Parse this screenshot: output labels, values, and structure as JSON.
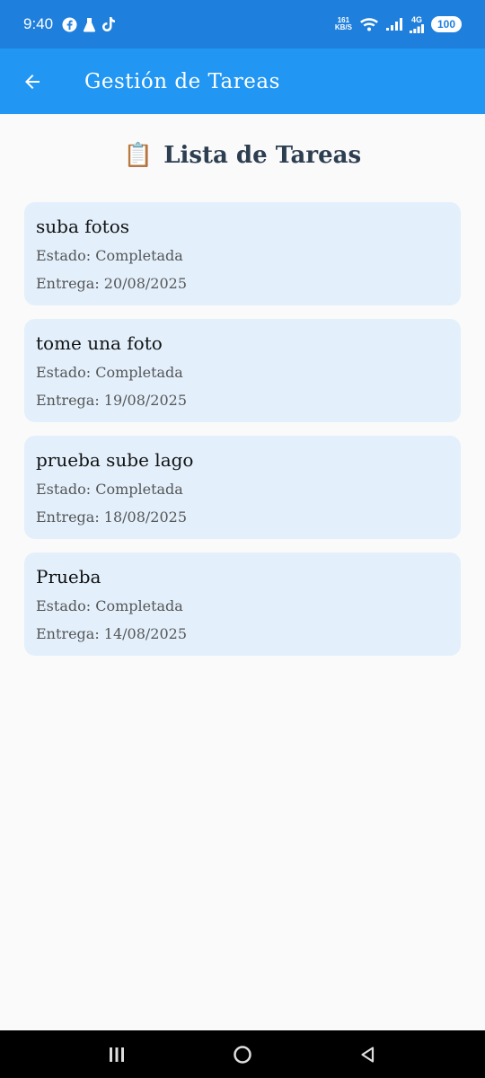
{
  "status_bar": {
    "time": "9:40",
    "speed_value": "161",
    "speed_unit": "KB/S",
    "network": "4G",
    "battery": "100"
  },
  "app_bar": {
    "title": "Gestión de Tareas",
    "back_icon": "arrow-left-icon"
  },
  "page": {
    "icon": "📋",
    "heading": "Lista de Tareas"
  },
  "tasks": [
    {
      "title": "suba fotos",
      "status": "Estado: Completada",
      "due": "Entrega: 20/08/2025"
    },
    {
      "title": "tome una foto",
      "status": "Estado: Completada",
      "due": "Entrega: 19/08/2025"
    },
    {
      "title": "prueba sube lago",
      "status": "Estado: Completada",
      "due": "Entrega: 18/08/2025"
    },
    {
      "title": "Prueba",
      "status": "Estado: Completada",
      "due": "Entrega: 14/08/2025"
    }
  ],
  "colors": {
    "status_bar": "#1e7fdc",
    "app_bar": "#2196f3",
    "card_bg": "#e3f0fc",
    "heading": "#2d3e50"
  }
}
